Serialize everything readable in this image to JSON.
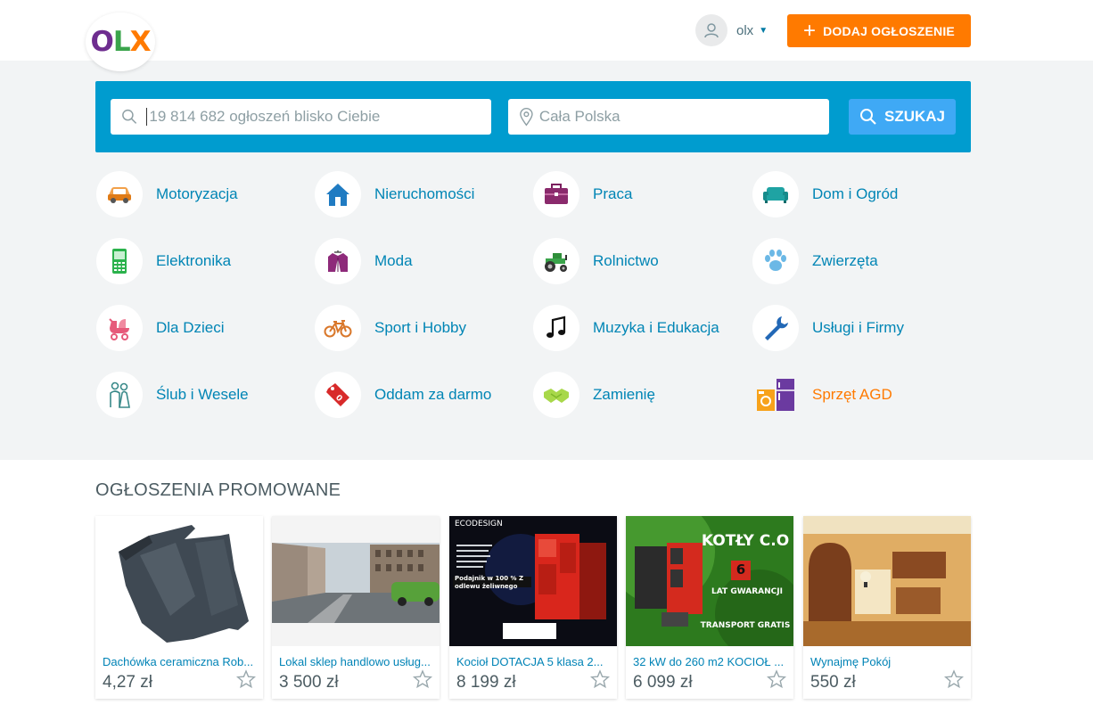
{
  "header": {
    "logo_text": "OLX",
    "logo_colors": [
      "#6e2d8f",
      "#3aa44b",
      "#ff7a00"
    ],
    "user_name": "olx",
    "add_button_label": "DODAJ OGŁOSZENIE"
  },
  "search": {
    "query_placeholder": "19 814 682 ogłoszeń blisko Ciebie",
    "location_placeholder": "Cała Polska",
    "button_label": "SZUKAJ"
  },
  "categories": [
    {
      "label": "Motoryzacja",
      "icon": "car-icon"
    },
    {
      "label": "Nieruchomości",
      "icon": "house-icon"
    },
    {
      "label": "Praca",
      "icon": "briefcase-icon"
    },
    {
      "label": "Dom i Ogród",
      "icon": "sofa-icon"
    },
    {
      "label": "Elektronika",
      "icon": "phone-icon"
    },
    {
      "label": "Moda",
      "icon": "jacket-icon"
    },
    {
      "label": "Rolnictwo",
      "icon": "tractor-icon"
    },
    {
      "label": "Zwierzęta",
      "icon": "paw-icon"
    },
    {
      "label": "Dla Dzieci",
      "icon": "stroller-icon"
    },
    {
      "label": "Sport i Hobby",
      "icon": "bicycle-icon"
    },
    {
      "label": "Muzyka i Edukacja",
      "icon": "music-note-icon"
    },
    {
      "label": "Usługi i Firmy",
      "icon": "wrench-icon"
    },
    {
      "label": "Ślub i Wesele",
      "icon": "wedding-couple-icon"
    },
    {
      "label": "Oddam za darmo",
      "icon": "price-tag-icon"
    },
    {
      "label": "Zamienię",
      "icon": "handshake-icon"
    },
    {
      "label": "Sprzęt AGD",
      "icon": "appliances-icon"
    }
  ],
  "promoted": {
    "title": "OGŁOSZENIA PROMOWANE",
    "items": [
      {
        "title": "Dachówka ceramiczna Rob...",
        "price": "4,27 zł"
      },
      {
        "title": "Lokal sklep handlowo usług...",
        "price": "3 500 zł"
      },
      {
        "title": "Kocioł DOTACJA 5 klasa 2...",
        "price": "8 199 zł"
      },
      {
        "title": "32 kW do 260 m2 KOCIOŁ ...",
        "price": "6 099 zł"
      },
      {
        "title": "Wynajmę Pokój",
        "price": "550 zł"
      }
    ],
    "image_texts": {
      "ecodesign": "ECODESIGN",
      "kotly": "KOTŁY C.O",
      "kotly_number": "6",
      "kotly_gwarancja": "LAT GWARANCJI",
      "kotly_transport": "TRANSPORT GRATIS",
      "boiler_promo": "Podajnik w 100 % Z odlewu żeliwnego"
    }
  },
  "colors": {
    "accent_orange": "#ff7a00",
    "search_bar": "#009ccf",
    "search_button": "#3fa9f5",
    "link_blue": "#0085b5"
  }
}
